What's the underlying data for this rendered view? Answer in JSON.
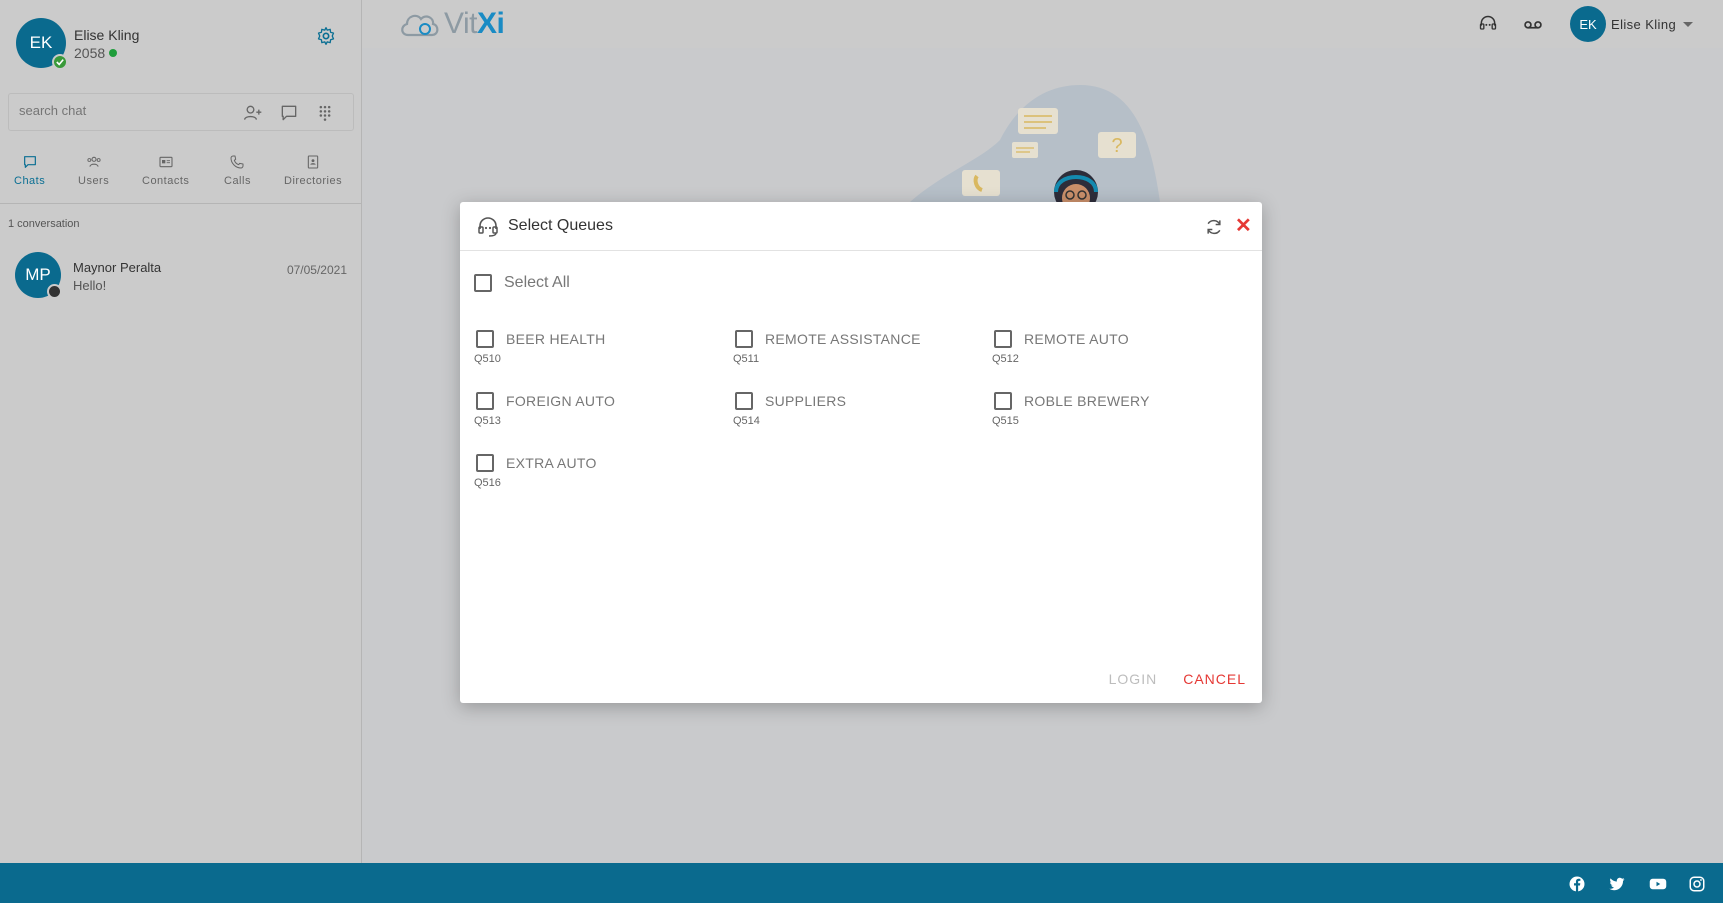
{
  "user": {
    "initials": "EK",
    "name": "Elise Kling",
    "extension": "2058"
  },
  "search": {
    "placeholder": "search chat"
  },
  "tabs": [
    {
      "label": "Chats"
    },
    {
      "label": "Users"
    },
    {
      "label": "Contacts"
    },
    {
      "label": "Calls"
    },
    {
      "label": "Directories"
    }
  ],
  "conversations": {
    "count_label": "1 conversation",
    "items": [
      {
        "initials": "MP",
        "name": "Maynor Peralta",
        "message": "Hello!",
        "date": "07/05/2021"
      }
    ]
  },
  "topbar": {
    "logo_prefix": "Vit",
    "logo_suffix": "Xi",
    "user_initials": "EK",
    "user_name": "Elise Kling"
  },
  "modal": {
    "title": "Select Queues",
    "select_all_label": "Select All",
    "queues": [
      {
        "name": "BEER HEALTH",
        "code": "Q510",
        "checked": false
      },
      {
        "name": "REMOTE ASSISTANCE",
        "code": "Q511",
        "checked": false
      },
      {
        "name": "REMOTE AUTO",
        "code": "Q512",
        "checked": false
      },
      {
        "name": "FOREIGN AUTO",
        "code": "Q513",
        "checked": false
      },
      {
        "name": "SUPPLIERS",
        "code": "Q514",
        "checked": false
      },
      {
        "name": "ROBLE BREWERY",
        "code": "Q515",
        "checked": false
      },
      {
        "name": "EXTRA AUTO",
        "code": "Q516",
        "checked": false
      }
    ],
    "login_label": "LOGIN",
    "cancel_label": "CANCEL"
  },
  "colors": {
    "brand": "#0a6a8e",
    "accent_red": "#e53935",
    "online": "#1f9d3b"
  }
}
